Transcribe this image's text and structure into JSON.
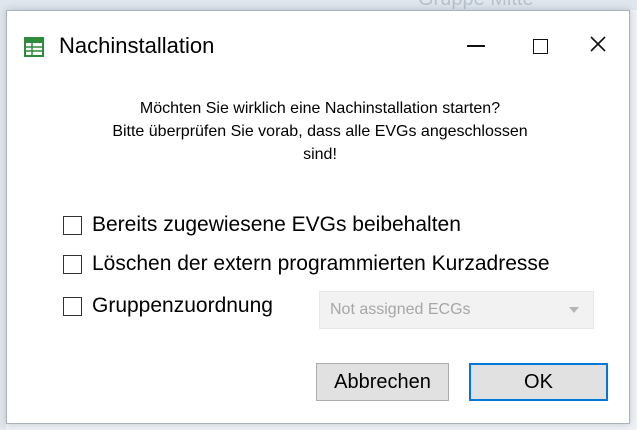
{
  "background": {
    "partial_text": "Gruppe Mitte"
  },
  "window": {
    "title": "Nachinstallation",
    "icon": "table-app-icon",
    "controls": {
      "minimize": "minimize-icon",
      "maximize": "maximize-icon",
      "close_glyph": "✕"
    }
  },
  "message": {
    "line1": "Möchten Sie wirklich eine Nachinstallation starten?",
    "line2": "Bitte überprüfen Sie vorab, dass alle EVGs angeschlossen",
    "line3": "sind!"
  },
  "options": [
    {
      "label": "Bereits zugewiesene EVGs beibehalten",
      "checked": false
    },
    {
      "label": "Löschen der extern programmierten Kurzadresse",
      "checked": false
    },
    {
      "label": "Gruppenzuordnung",
      "checked": false
    }
  ],
  "group_select": {
    "value": "Not assigned ECGs",
    "disabled": true
  },
  "buttons": {
    "cancel": "Abbrechen",
    "ok": "OK"
  },
  "colors": {
    "accent": "#0078d7",
    "icon_green": "#2e8b3c"
  }
}
